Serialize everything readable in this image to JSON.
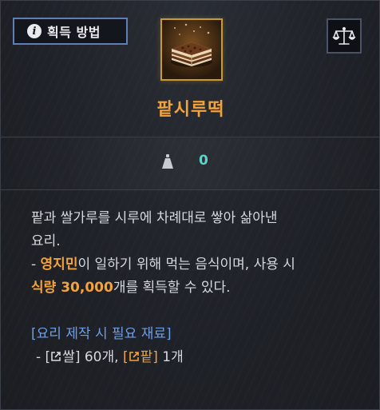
{
  "header": {
    "acquire_label": "획득 방법"
  },
  "item": {
    "name": "팥시루떡",
    "weight": "0"
  },
  "description": {
    "line1": "팥과 쌀가루를 시루에 차례대로 쌓아 삶아낸",
    "line2": "요리.",
    "line3_prefix": "- ",
    "line3_highlight": "영지민",
    "line3_suffix": "이 일하기 위해 먹는 음식이며, 사용 시",
    "line4_highlight": "식량 30,000",
    "line4_suffix": "개를 획득할 수 있다."
  },
  "requirements": {
    "title": "[요리 제작 시 필요 재료]",
    "prefix": "- [",
    "mat1_name": "쌀",
    "mat1_suffix": "] 60개, ",
    "mat2_open": "[",
    "mat2_name": "팥",
    "mat2_suffix": "]",
    "mat2_count": " 1개"
  },
  "colors": {
    "accent_orange": "#f3a33a",
    "link_blue": "#6f9ee6",
    "weight_teal": "#5fd3c5",
    "frame_gold": "#c99a2e",
    "button_border": "#5d7fb6"
  },
  "icons": {
    "info": "info-icon",
    "compare": "scales-icon",
    "weight": "weight-icon",
    "link": "external-link-icon"
  }
}
